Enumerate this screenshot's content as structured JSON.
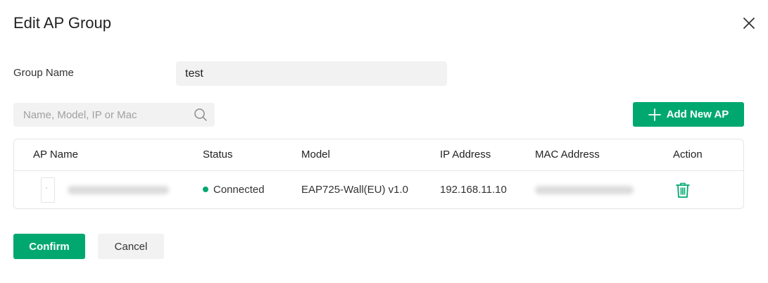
{
  "dialog": {
    "title": "Edit AP Group"
  },
  "form": {
    "group_name_label": "Group Name",
    "group_name_value": "test"
  },
  "search": {
    "placeholder": "Name, Model, IP or Mac"
  },
  "toolbar": {
    "add_label": "Add New AP"
  },
  "table": {
    "headers": {
      "name": "AP Name",
      "status": "Status",
      "model": "Model",
      "ip": "IP Address",
      "mac": "MAC Address",
      "action": "Action"
    },
    "rows": [
      {
        "status": "Connected",
        "model": "EAP725-Wall(EU) v1.0",
        "ip": "192.168.11.10"
      }
    ]
  },
  "footer": {
    "confirm_label": "Confirm",
    "cancel_label": "Cancel"
  },
  "colors": {
    "accent": "#00a870",
    "field_bg": "#f2f2f2",
    "border": "#e6e6e6"
  },
  "icons": {
    "close": "close-icon",
    "search": "search-icon",
    "add": "plus-icon",
    "delete": "trash-icon"
  }
}
